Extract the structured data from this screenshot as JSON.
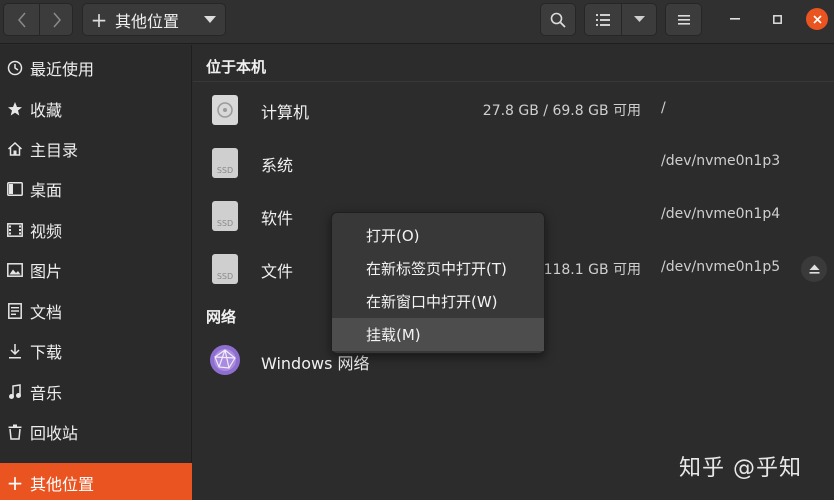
{
  "header": {
    "location_label": "其他位置"
  },
  "sidebar": {
    "items": [
      {
        "label": "最近使用",
        "icon": "clock-icon"
      },
      {
        "label": "收藏",
        "icon": "star-icon"
      },
      {
        "label": "主目录",
        "icon": "home-icon"
      },
      {
        "label": "桌面",
        "icon": "desktop-icon"
      },
      {
        "label": "视频",
        "icon": "video-icon"
      },
      {
        "label": "图片",
        "icon": "image-icon"
      },
      {
        "label": "文档",
        "icon": "document-icon"
      },
      {
        "label": "下载",
        "icon": "download-icon"
      },
      {
        "label": "音乐",
        "icon": "music-icon"
      },
      {
        "label": "回收站",
        "icon": "trash-icon"
      },
      {
        "label": "其他位置",
        "icon": "plus-icon",
        "active": true
      }
    ]
  },
  "main": {
    "local_section": "位于本机",
    "network_section": "网络",
    "devices": [
      {
        "name": "计算机",
        "capacity": "27.8 GB / 69.8 GB 可用",
        "mount": "/",
        "icon": "harddisk-icon"
      },
      {
        "name": "系统",
        "capacity": "",
        "mount": "/dev/nvme0n1p3",
        "icon": "ssd-icon"
      },
      {
        "name": "软件",
        "capacity": "",
        "mount": "/dev/nvme0n1p4",
        "icon": "ssd-icon"
      },
      {
        "name": "文件",
        "capacity": "118.1 GB 可用",
        "mount": "/dev/nvme0n1p5",
        "icon": "ssd-icon"
      }
    ],
    "network": [
      {
        "name": "Windows 网络",
        "icon": "network-icon"
      }
    ]
  },
  "context_menu": {
    "items": [
      {
        "label": "打开(O)"
      },
      {
        "label": "在新标签页中打开(T)"
      },
      {
        "label": "在新窗口中打开(W)"
      },
      {
        "label": "挂载(M)",
        "highlighted": true
      }
    ]
  },
  "watermark": "知乎 @乎知",
  "colors": {
    "accent": "#e95420",
    "background": "#2c2c2c",
    "sidebar": "#2a2a2a"
  }
}
